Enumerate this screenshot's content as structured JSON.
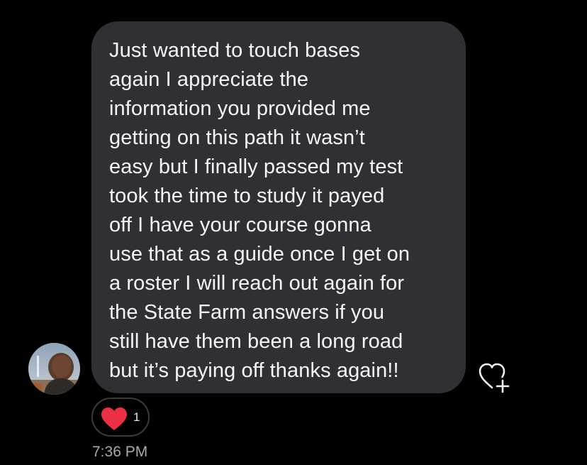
{
  "message": {
    "lines": [
      "Just wanted to touch bases",
      "again I appreciate the",
      "information you provided me",
      "getting on this path it wasn’t",
      "easy but I finally passed my test",
      "took the time to study it payed",
      "off I have your course gonna",
      "use that as a guide once I get on",
      "a roster I will reach out again for",
      "the State Farm answers if you",
      "still have them been a long road",
      "but it’s paying off thanks again!!"
    ],
    "timestamp": "7:36 PM"
  },
  "reaction": {
    "emoji": "heart-icon",
    "count": "1"
  },
  "icons": {
    "avatar": "avatar-photo",
    "like": "heart-plus-icon"
  },
  "colors": {
    "background": "#000000",
    "bubble": "#2e3033",
    "text": "#f5f5f5",
    "heart": "#ed2f45",
    "timestamp": "#a9a9ad"
  }
}
